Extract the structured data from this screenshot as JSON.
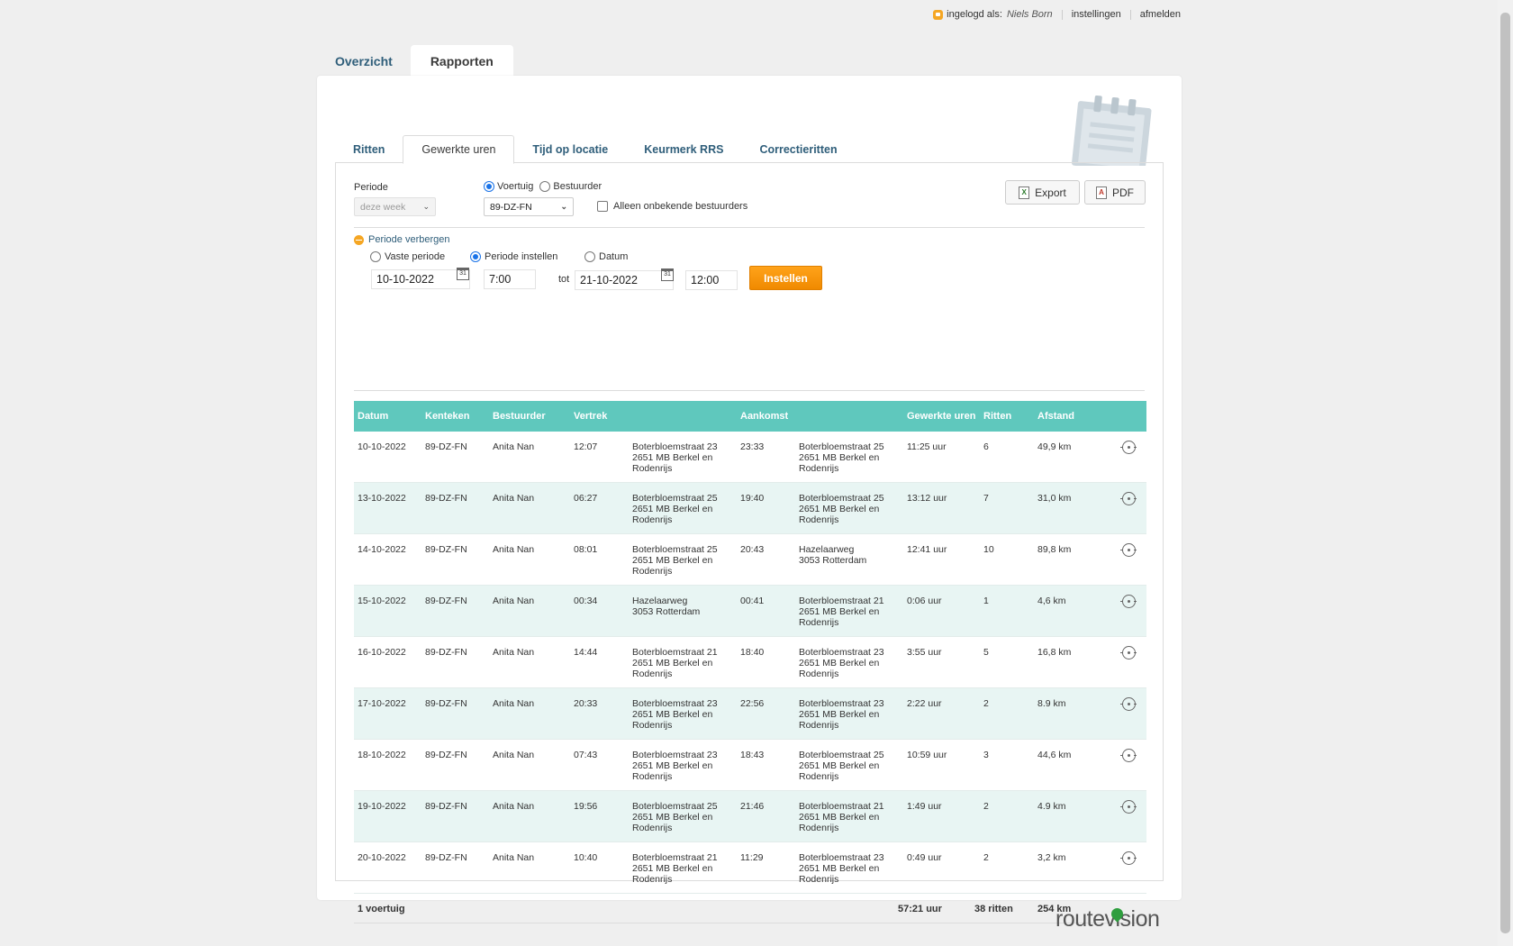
{
  "topbar": {
    "logged_in_label": "ingelogd als:",
    "user": "Niels Born",
    "settings": "instellingen",
    "logout": "afmelden"
  },
  "main_tabs": [
    {
      "label": "Overzicht"
    },
    {
      "label": "Rapporten"
    }
  ],
  "sub_tabs": [
    {
      "label": "Ritten"
    },
    {
      "label": "Gewerkte uren"
    },
    {
      "label": "Tijd op locatie"
    },
    {
      "label": "Keurmerk RRS"
    },
    {
      "label": "Correctieritten"
    }
  ],
  "filters": {
    "periode_label": "Periode",
    "periode_value": "deze week",
    "voertuig_label": "Voertuig",
    "bestuurder_label": "Bestuurder",
    "vehicle_value": "89-DZ-FN",
    "unknown_drivers_label": "Alleen onbekende bestuurders",
    "export_label": "Export",
    "pdf_label": "PDF"
  },
  "period": {
    "toggle_label": "Periode verbergen",
    "option_fixed": "Vaste periode",
    "option_custom": "Periode instellen",
    "option_date": "Datum",
    "from_date": "10-10-2022",
    "from_time": "7:00",
    "to_label": "tot",
    "to_date": "21-10-2022",
    "to_time": "12:00",
    "apply_label": "Instellen"
  },
  "table": {
    "headers": {
      "datum": "Datum",
      "kenteken": "Kenteken",
      "bestuurder": "Bestuurder",
      "vertrek": "Vertrek",
      "aankomst": "Aankomst",
      "uren": "Gewerkte uren",
      "ritten": "Ritten",
      "afstand": "Afstand"
    },
    "rows": [
      {
        "datum": "10-10-2022",
        "kenteken": "89-DZ-FN",
        "bestuurder": "Anita Nan",
        "vertrek_tijd": "12:07",
        "vertrek_adres": [
          "Boterbloemstraat 23",
          "2651 MB Berkel en",
          "Rodenrijs"
        ],
        "aankomst_tijd": "23:33",
        "aankomst_adres": [
          "Boterbloemstraat 25",
          "2651 MB Berkel en",
          "Rodenrijs"
        ],
        "uren": "11:25 uur",
        "ritten": "6",
        "afstand": "49,9 km"
      },
      {
        "datum": "13-10-2022",
        "kenteken": "89-DZ-FN",
        "bestuurder": "Anita Nan",
        "vertrek_tijd": "06:27",
        "vertrek_adres": [
          "Boterbloemstraat 25",
          "2651 MB Berkel en",
          "Rodenrijs"
        ],
        "aankomst_tijd": "19:40",
        "aankomst_adres": [
          "Boterbloemstraat 25",
          "2651 MB Berkel en",
          "Rodenrijs"
        ],
        "uren": "13:12 uur",
        "ritten": "7",
        "afstand": "31,0 km"
      },
      {
        "datum": "14-10-2022",
        "kenteken": "89-DZ-FN",
        "bestuurder": "Anita Nan",
        "vertrek_tijd": "08:01",
        "vertrek_adres": [
          "Boterbloemstraat 25",
          "2651 MB Berkel en",
          "Rodenrijs"
        ],
        "aankomst_tijd": "20:43",
        "aankomst_adres": [
          "Hazelaarweg",
          "3053 Rotterdam",
          ""
        ],
        "uren": "12:41 uur",
        "ritten": "10",
        "afstand": "89,8 km"
      },
      {
        "datum": "15-10-2022",
        "kenteken": "89-DZ-FN",
        "bestuurder": "Anita Nan",
        "vertrek_tijd": "00:34",
        "vertrek_adres": [
          "Hazelaarweg",
          "3053 Rotterdam",
          ""
        ],
        "aankomst_tijd": "00:41",
        "aankomst_adres": [
          "Boterbloemstraat 21",
          "2651 MB Berkel en",
          "Rodenrijs"
        ],
        "uren": "0:06 uur",
        "ritten": "1",
        "afstand": "4,6 km"
      },
      {
        "datum": "16-10-2022",
        "kenteken": "89-DZ-FN",
        "bestuurder": "Anita Nan",
        "vertrek_tijd": "14:44",
        "vertrek_adres": [
          "Boterbloemstraat 21",
          "2651 MB Berkel en",
          "Rodenrijs"
        ],
        "aankomst_tijd": "18:40",
        "aankomst_adres": [
          "Boterbloemstraat 23",
          "2651 MB Berkel en",
          "Rodenrijs"
        ],
        "uren": "3:55 uur",
        "ritten": "5",
        "afstand": "16,8 km"
      },
      {
        "datum": "17-10-2022",
        "kenteken": "89-DZ-FN",
        "bestuurder": "Anita Nan",
        "vertrek_tijd": "20:33",
        "vertrek_adres": [
          "Boterbloemstraat 23",
          "2651 MB Berkel en",
          "Rodenrijs"
        ],
        "aankomst_tijd": "22:56",
        "aankomst_adres": [
          "Boterbloemstraat 23",
          "2651 MB Berkel en",
          "Rodenrijs"
        ],
        "uren": "2:22 uur",
        "ritten": "2",
        "afstand": "8.9 km"
      },
      {
        "datum": "18-10-2022",
        "kenteken": "89-DZ-FN",
        "bestuurder": "Anita Nan",
        "vertrek_tijd": "07:43",
        "vertrek_adres": [
          "Boterbloemstraat 23",
          "2651 MB Berkel en",
          "Rodenrijs"
        ],
        "aankomst_tijd": "18:43",
        "aankomst_adres": [
          "Boterbloemstraat 25",
          "2651 MB Berkel en",
          "Rodenrijs"
        ],
        "uren": "10:59 uur",
        "ritten": "3",
        "afstand": "44,6 km"
      },
      {
        "datum": "19-10-2022",
        "kenteken": "89-DZ-FN",
        "bestuurder": "Anita Nan",
        "vertrek_tijd": "19:56",
        "vertrek_adres": [
          "Boterbloemstraat 25",
          "2651 MB Berkel en",
          "Rodenrijs"
        ],
        "aankomst_tijd": "21:46",
        "aankomst_adres": [
          "Boterbloemstraat 21",
          "2651 MB Berkel en",
          "Rodenrijs"
        ],
        "uren": "1:49 uur",
        "ritten": "2",
        "afstand": "4.9 km"
      },
      {
        "datum": "20-10-2022",
        "kenteken": "89-DZ-FN",
        "bestuurder": "Anita Nan",
        "vertrek_tijd": "10:40",
        "vertrek_adres": [
          "Boterbloemstraat 21",
          "2651 MB Berkel en",
          "Rodenrijs"
        ],
        "aankomst_tijd": "11:29",
        "aankomst_adres": [
          "Boterbloemstraat 23",
          "2651 MB Berkel en",
          "Rodenrijs"
        ],
        "uren": "0:49 uur",
        "ritten": "2",
        "afstand": "3,2 km"
      }
    ],
    "footer": {
      "count": "1 voertuig",
      "uren": "57:21 uur",
      "ritten": "38 ritten",
      "afstand": "254 km"
    }
  },
  "brand": {
    "logo": "routevision",
    "accent": "#f5a623",
    "header_color": "#5fc8bd"
  }
}
